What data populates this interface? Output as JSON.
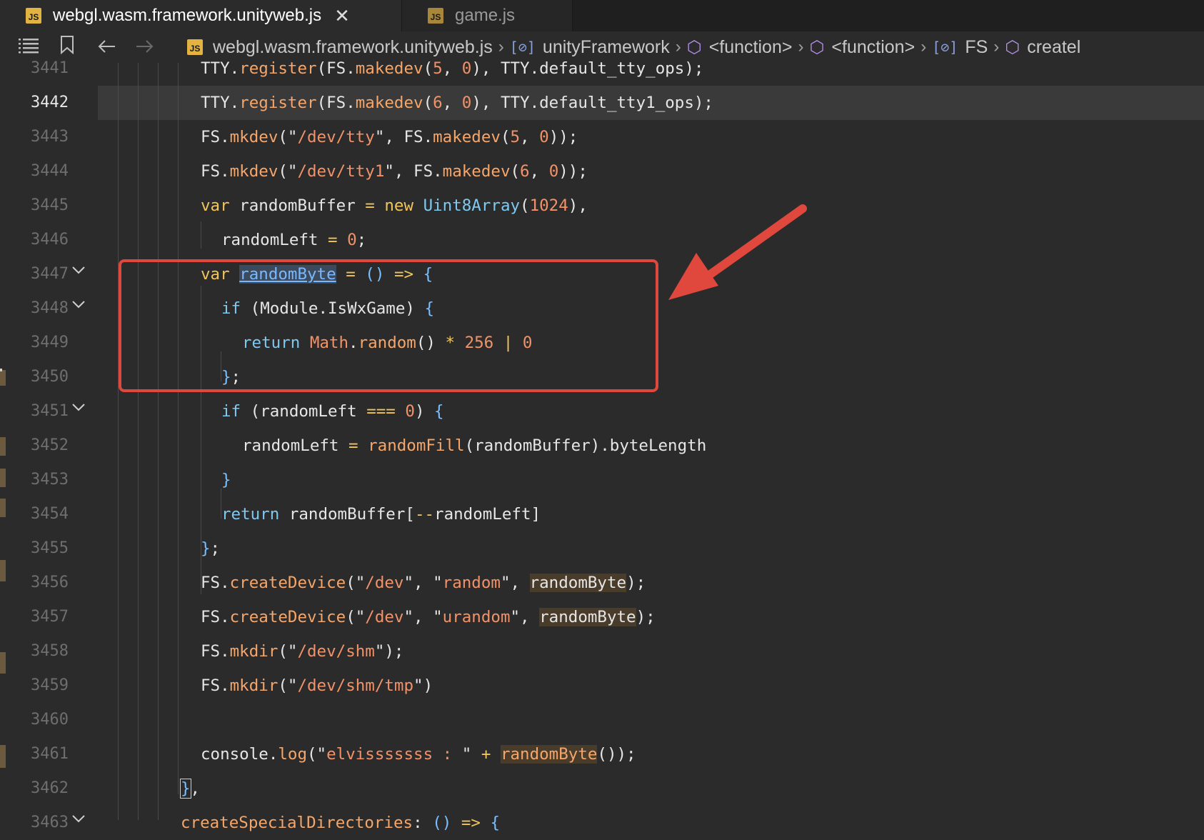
{
  "tabs": [
    {
      "label": "webgl.wasm.framework.unityweb.js",
      "icon": "JS",
      "active": true
    },
    {
      "label": "game.js",
      "icon": "JS",
      "active": false
    }
  ],
  "tab_close_glyph": "✕",
  "breadcrumb": {
    "file": "webgl.wasm.framework.unityweb.js",
    "items": [
      "unityFramework",
      "<function>",
      "<function>",
      "FS",
      "createl"
    ]
  },
  "line_numbers": [
    "3441",
    "3442",
    "3443",
    "3444",
    "3445",
    "3446",
    "3447",
    "3448",
    "3449",
    "3450",
    "3451",
    "3452",
    "3453",
    "3454",
    "3455",
    "3456",
    "3457",
    "3458",
    "3459",
    "3460",
    "3461",
    "3462",
    "3463"
  ],
  "current_line": "3442",
  "code": {
    "l3441": {
      "t1": "TTY",
      "t2": "register",
      "t3": "FS",
      "t4": "makedev",
      "n1": "5",
      "n2": "0",
      "t5": "TTY",
      "t6": "default_tty_ops"
    },
    "l3442": {
      "t1": "TTY",
      "t2": "register",
      "t3": "FS",
      "t4": "makedev",
      "n1": "6",
      "n2": "0",
      "t5": "TTY",
      "t6": "default_tty1_ops"
    },
    "l3443": {
      "t1": "FS",
      "t2": "mkdev",
      "s1": "/dev/tty",
      "t3": "FS",
      "t4": "makedev",
      "n1": "5",
      "n2": "0"
    },
    "l3444": {
      "t1": "FS",
      "t2": "mkdev",
      "s1": "/dev/tty1",
      "t3": "FS",
      "t4": "makedev",
      "n1": "6",
      "n2": "0"
    },
    "l3445": {
      "kw": "var",
      "name": "randomBuffer",
      "kw2": "new",
      "cls": "Uint8Array",
      "n1": "1024"
    },
    "l3446": {
      "name": "randomLeft",
      "n1": "0"
    },
    "l3447": {
      "kw": "var",
      "name": "randomByte"
    },
    "l3448": {
      "kw": "if",
      "t1": "Module",
      "t2": "IsWxGame"
    },
    "l3449": {
      "kw": "return",
      "t1": "Math",
      "t2": "random",
      "n1": "256",
      "n2": "0"
    },
    "l3451": {
      "kw": "if",
      "name": "randomLeft",
      "n1": "0"
    },
    "l3452": {
      "name": "randomLeft",
      "fn": "randomFill",
      "arg": "randomBuffer",
      "prop": "byteLength"
    },
    "l3454": {
      "kw": "return",
      "name": "randomBuffer",
      "idx": "randomLeft"
    },
    "l3456": {
      "t1": "FS",
      "t2": "createDevice",
      "s1": "/dev",
      "s2": "random",
      "arg": "randomByte"
    },
    "l3457": {
      "t1": "FS",
      "t2": "createDevice",
      "s1": "/dev",
      "s2": "urandom",
      "arg": "randomByte"
    },
    "l3458": {
      "t1": "FS",
      "t2": "mkdir",
      "s1": "/dev/shm"
    },
    "l3459": {
      "t1": "FS",
      "t2": "mkdir",
      "s1": "/dev/shm/tmp"
    },
    "l3461": {
      "t1": "console",
      "t2": "log",
      "s1": "elvisssssss : ",
      "fn": "randomByte"
    },
    "l3463": {
      "name": "createSpecialDirectories"
    }
  },
  "colors": {
    "annotation": "#e0483d",
    "accent_js": "#e3b341"
  }
}
